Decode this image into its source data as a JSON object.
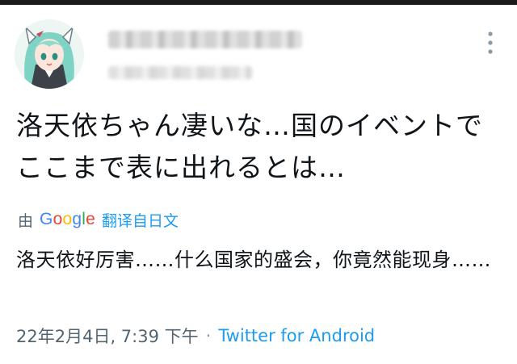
{
  "tweet": {
    "author": {
      "avatar_icon": "anime-avatar-icon"
    },
    "text": "洛天依ちゃん凄いな…国のイベントでここまで表に出れるとは…",
    "translation": {
      "prefix": "由",
      "provider": "Google",
      "link_label": "翻译自日文",
      "text": "洛天依好厉害……什么国家的盛会，你竟然能现身……"
    },
    "timestamp": "22年2月4日, 7:39 下午",
    "separator": "·",
    "source": "Twitter for Android"
  },
  "colors": {
    "text": "#0f1419",
    "secondary": "#536471",
    "link": "#1d9bf0"
  }
}
